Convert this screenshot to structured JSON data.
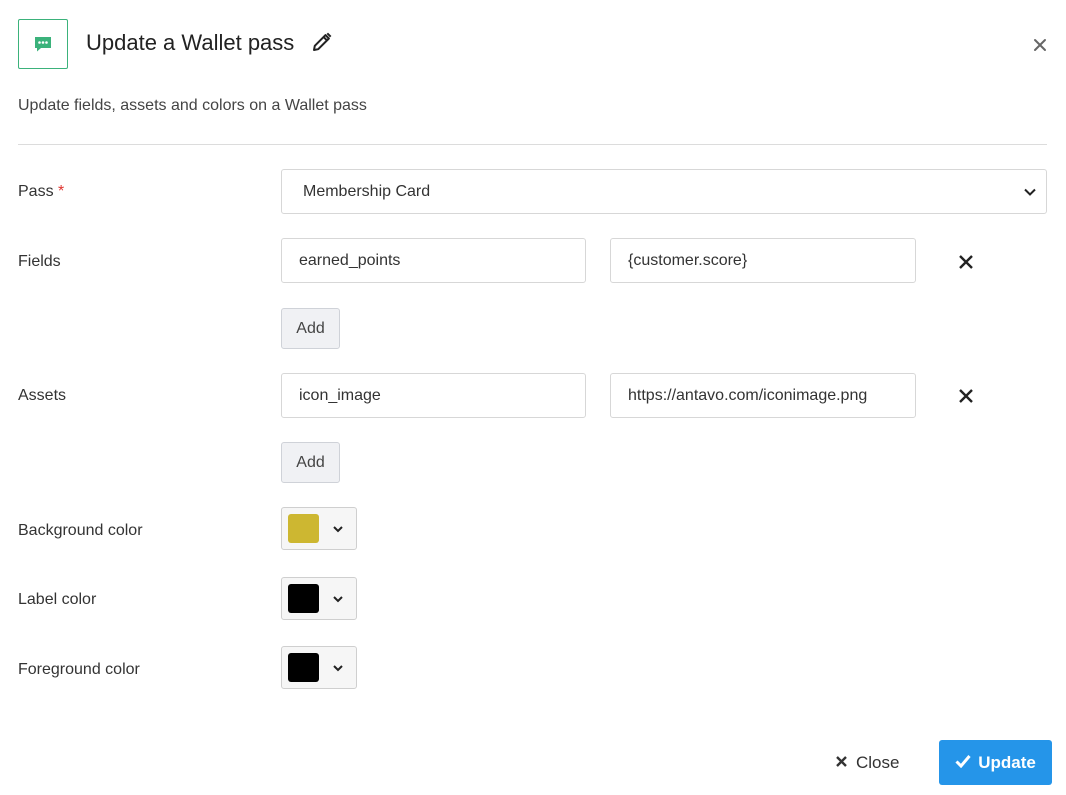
{
  "dialog": {
    "title": "Update a Wallet pass",
    "subtitle": "Update fields, assets and colors on a Wallet pass",
    "header_icon": "chat-bubble-icon",
    "accent_color": "#3bb27b"
  },
  "pass": {
    "label": "Pass",
    "required_marker": "*",
    "selected": "Membership Card"
  },
  "fields": {
    "label": "Fields",
    "rows": [
      {
        "key": "earned_points",
        "value": "{customer.score}"
      }
    ],
    "add_label": "Add"
  },
  "assets": {
    "label": "Assets",
    "rows": [
      {
        "key": "icon_image",
        "value": "https://antavo.com/iconimage.png"
      }
    ],
    "add_label": "Add"
  },
  "colors": {
    "background": {
      "label": "Background color",
      "value": "#cdb731"
    },
    "label_color": {
      "label": "Label color",
      "value": "#000000"
    },
    "foreground": {
      "label": "Foreground color",
      "value": "#000000"
    }
  },
  "footer": {
    "close_label": "Close",
    "update_label": "Update",
    "primary_color": "#2595e9"
  }
}
